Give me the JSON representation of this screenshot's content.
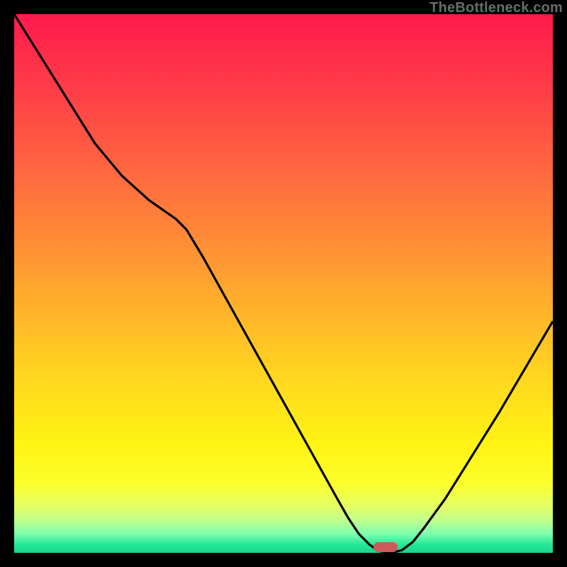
{
  "watermark": "TheBottleneck.com",
  "colors": {
    "frame": "#000000",
    "curve": "#000000",
    "marker": "#cc5a5a",
    "gradient_top": "#ff1a4d",
    "gradient_bottom": "#1dd38c"
  },
  "chart_data": {
    "type": "line",
    "title": "",
    "xlabel": "",
    "ylabel": "",
    "xlim": [
      0,
      100
    ],
    "ylim": [
      0,
      100
    ],
    "x": [
      0,
      5,
      10,
      15,
      20,
      25,
      30,
      32,
      35,
      40,
      45,
      50,
      55,
      60,
      62,
      64,
      66,
      67,
      68,
      69,
      70,
      72,
      74,
      76,
      80,
      85,
      90,
      95,
      100
    ],
    "values": [
      100,
      92,
      84,
      76,
      70,
      65.5,
      62,
      60,
      55,
      46,
      37,
      28,
      19,
      10,
      6.5,
      3.5,
      1.5,
      0.8,
      0.3,
      0.0,
      0.0,
      0.5,
      2.0,
      4.5,
      10,
      18,
      26,
      34.5,
      43
    ],
    "marker": {
      "x": 69,
      "y": 0.8
    },
    "annotations": []
  }
}
